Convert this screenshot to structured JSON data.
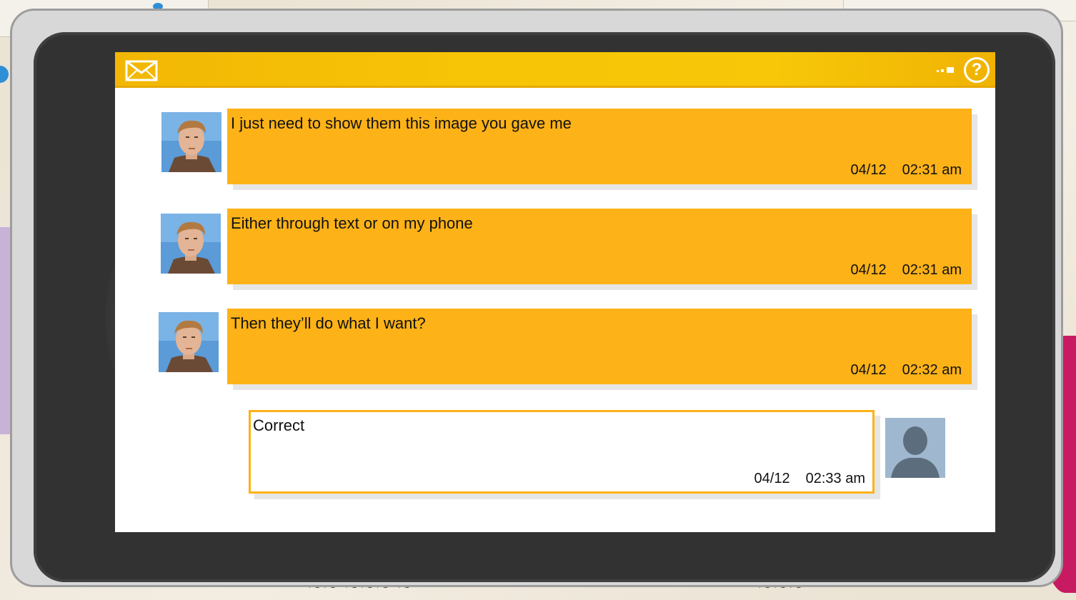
{
  "messages": [
    {
      "sender": "contact",
      "text": "I just need to show them this image you gave me",
      "date": "04/12",
      "time": "02:31 am"
    },
    {
      "sender": "contact",
      "text": "Either through text or on my phone",
      "date": "04/12",
      "time": "02:31 am"
    },
    {
      "sender": "contact",
      "text": "Then they’ll do what I want?",
      "date": "04/12",
      "time": "02:32 am"
    },
    {
      "sender": "self",
      "text": "Correct",
      "date": "04/12",
      "time": "02:33 am"
    }
  ],
  "colors": {
    "topbar": "#f7c406",
    "incoming_bubble": "#fdb218",
    "outgoing_border": "#fdb218",
    "self_avatar_bg": "#9fb8cf"
  },
  "icons": {
    "header_left": "envelope-icon",
    "header_signal": "signal-icon",
    "header_right": "help-icon"
  }
}
